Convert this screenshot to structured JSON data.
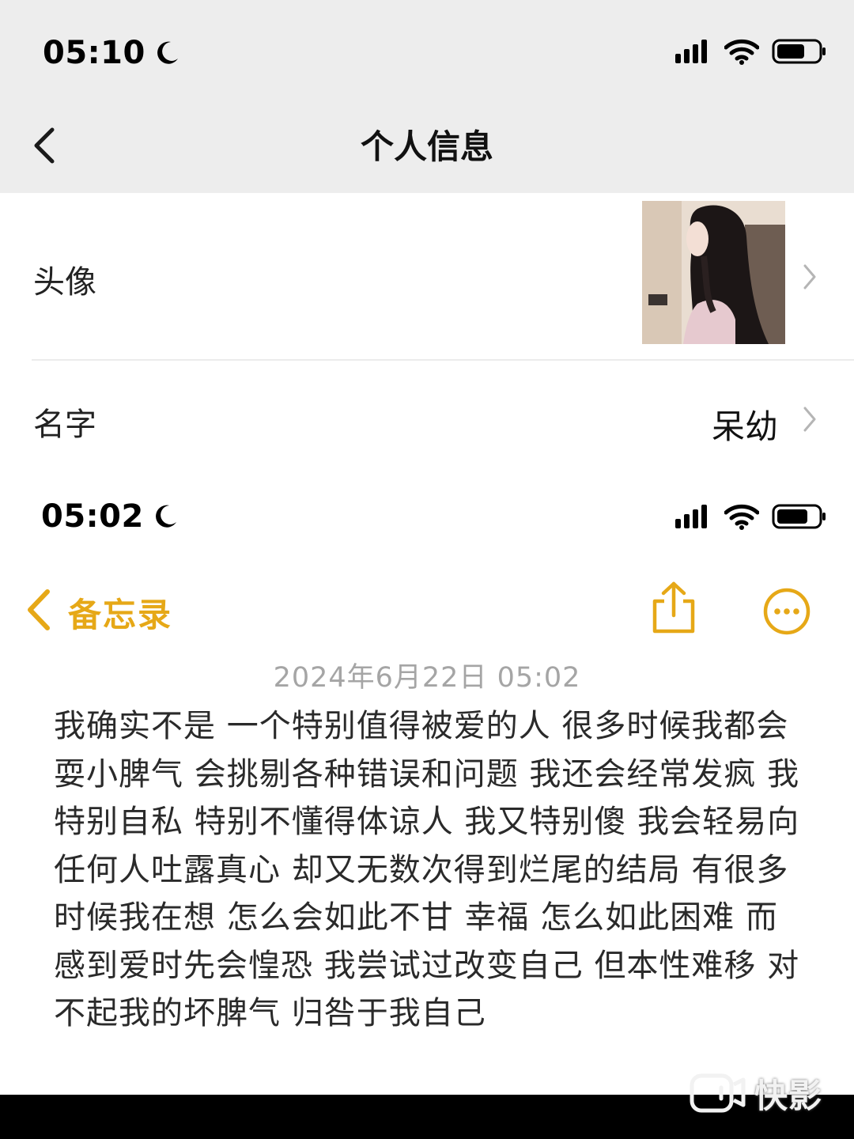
{
  "profile_screen": {
    "status_bar": {
      "time": "05:10"
    },
    "nav": {
      "title": "个人信息"
    },
    "rows": [
      {
        "label": "头像"
      },
      {
        "label": "名字",
        "value": "呆幼"
      }
    ]
  },
  "notes_screen": {
    "status_bar": {
      "time": "05:02"
    },
    "nav": {
      "back_label": "备忘录"
    },
    "note": {
      "date": "2024年6月22日 05:02",
      "body": "我确实不是 一个特别值得被爱的人 很多时候我都会耍小脾气 会挑剔各种错误和问题 我还会经常发疯 我特别自私 特别不懂得体谅人 我又特别傻 我会轻易向任何人吐露真心 却又无数次得到烂尾的结局 有很多时候我在想 怎么会如此不甘 幸福 怎么如此困难 而感到爱时先会惶恐 我尝试过改变自己 但本性难移 对不起我的坏脾气 归咎于我自己"
    }
  },
  "watermark": {
    "text": "快影"
  },
  "colors": {
    "accent": "#e6a817",
    "nav_gray": "#ededed"
  }
}
